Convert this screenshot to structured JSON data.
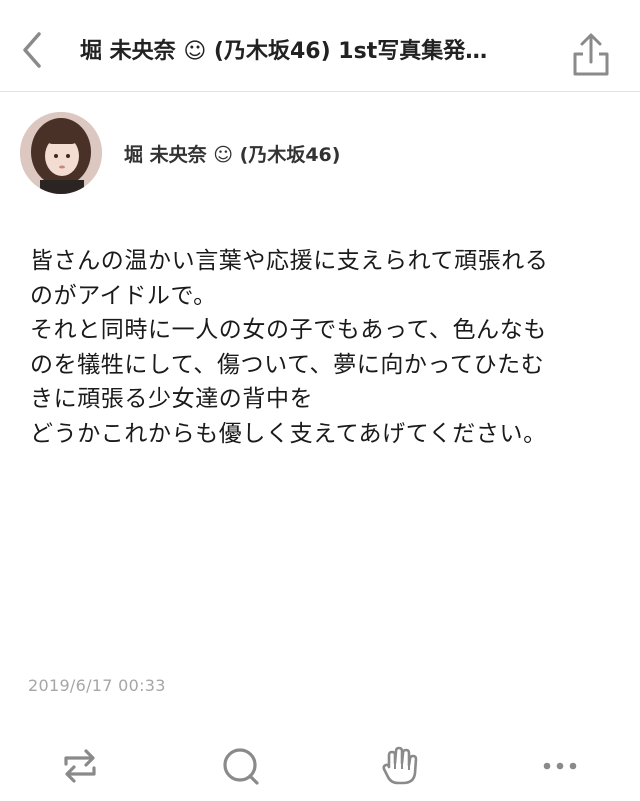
{
  "header": {
    "title": "堀 未央奈 ☺ (乃木坂46) 1st写真集発…",
    "back_icon": "chevron-left-icon",
    "share_icon": "share-icon"
  },
  "author": {
    "name": "堀 未央奈 ☺ (乃木坂46)"
  },
  "post": {
    "body": "皆さんの温かい言葉や応援に支えられて頑張れる\nのがアイドルで。\nそれと同時に一人の女の子でもあって、色んなも\nのを犠牲にして、傷ついて、夢に向かってひたむ\nきに頑張る少女達の背中を\nどうかこれからも優しく支えてあげてください。",
    "timestamp": "2019/6/17 00:33"
  },
  "actions": [
    {
      "icon": "repost-icon"
    },
    {
      "icon": "comment-icon"
    },
    {
      "icon": "clap-icon"
    },
    {
      "icon": "more-icon"
    }
  ],
  "colors": {
    "icon": "#8a8a8a",
    "divider": "#e3e3e3",
    "timestamp": "#a6a6a6"
  }
}
